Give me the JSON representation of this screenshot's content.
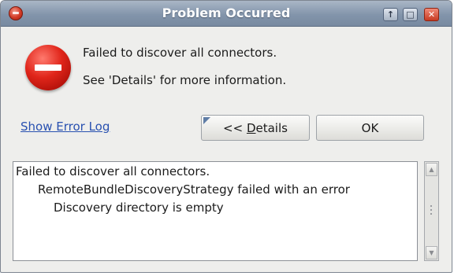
{
  "window": {
    "title": "Problem Occurred",
    "controls": [
      "minimize",
      "maximize",
      "close"
    ]
  },
  "message": {
    "line1": "Failed to discover all connectors.",
    "line2": "See 'Details' for more information."
  },
  "links": {
    "show_error_log": "Show Error Log"
  },
  "buttons": {
    "details_prefix": "<< ",
    "details_mnemonic": "D",
    "details_rest": "etails",
    "ok": "OK"
  },
  "details": {
    "lines": [
      "Failed to discover all connectors.",
      "RemoteBundleDiscoveryStrategy failed with an error",
      "Discovery directory is empty"
    ]
  },
  "icons": {
    "app": "eclipse-app-icon",
    "error": "error-stop-icon",
    "scroll_up": "scroll-up-arrow",
    "scroll_down": "scroll-down-arrow"
  },
  "colors": {
    "titlebar": "#8395ab",
    "link": "#2850b0",
    "error_red": "#e0251a"
  }
}
